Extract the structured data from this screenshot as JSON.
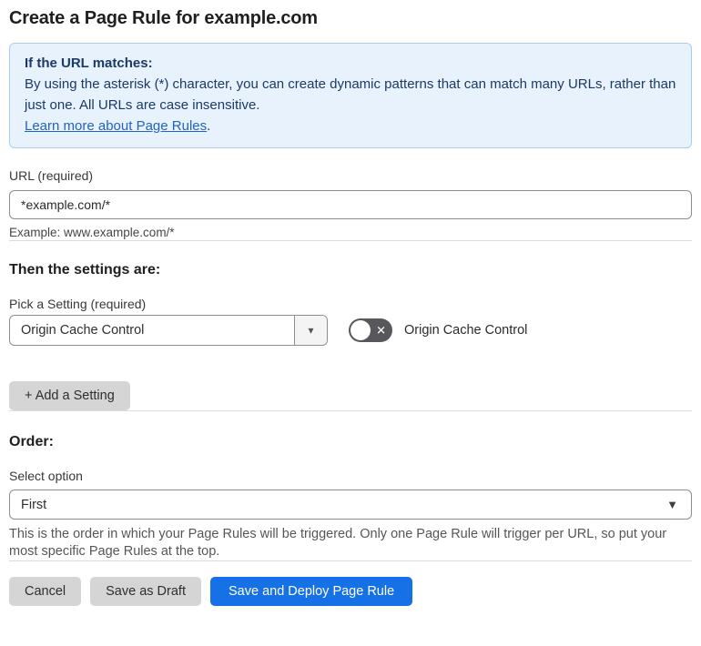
{
  "page": {
    "title": "Create a Page Rule for example.com"
  },
  "info_box": {
    "heading": "If the URL matches:",
    "body": "By using the asterisk (*) character, you can create dynamic patterns that can match many URLs, rather than just one. All URLs are case insensitive.",
    "link": "Learn more about Page Rules",
    "link_suffix": "."
  },
  "url_field": {
    "label": "URL (required)",
    "value": "*example.com/*",
    "helper": "Example: www.example.com/*"
  },
  "settings_section": {
    "heading": "Then the settings are:",
    "picker_label": "Pick a Setting (required)",
    "picker_value": "Origin Cache Control",
    "toggle_label": "Origin Cache Control",
    "toggle_state": "off",
    "add_setting_label": "+ Add a Setting"
  },
  "order_section": {
    "heading": "Order:",
    "select_label": "Select option",
    "select_value": "First",
    "helper": "This is the order in which your Page Rules will be triggered. Only one Page Rule will trigger per URL, so put your most specific Page Rules at the top."
  },
  "footer": {
    "cancel_label": "Cancel",
    "save_draft_label": "Save as Draft",
    "save_deploy_label": "Save and Deploy Page Rule"
  },
  "icons": {
    "picker_dropdown_caret": "▾",
    "order_select_caret": "▼",
    "toggle_off_x": "✕"
  },
  "colors": {
    "accent_blue": "#1671e6",
    "info_box_bg": "#e8f2fc",
    "info_box_border": "#aacdee",
    "info_text_navy": "#1b3a66",
    "link_blue": "#2063c9",
    "toggle_off_bg": "#58585c",
    "gray_button_bg": "#d5d5d5",
    "divider": "#dcdcdc"
  }
}
